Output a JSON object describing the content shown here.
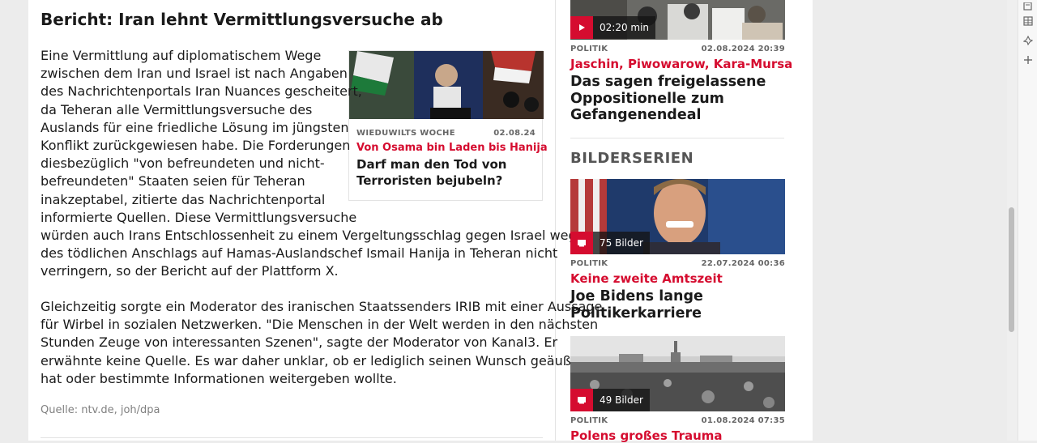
{
  "article": {
    "headline": "Bericht: Iran lehnt Vermittlungsversuche ab",
    "paragraph1_lines": [
      "Eine Vermittlung auf diplomatischem Wege",
      "zwischen dem Iran und Israel ist nach Angaben",
      "des Nachrichtenportals Iran Nuances gescheitert,",
      "da Teheran alle Vermittlungsversuche des",
      "Auslands für eine friedliche Lösung im jüngsten",
      "Konflikt zurückgewiesen habe. Die Forderungen",
      "diesbezüglich \"von befreundeten und nicht-",
      "befreundeten\" Staaten seien für Teheran",
      "inakzeptabel, zitierte das Nachrichtenportal",
      "informierte Quellen. Diese Vermittlungsversuche",
      "würden auch Irans Entschlossenheit zu einem Vergeltungsschlag gegen Israel wegen",
      "des tödlichen Anschlags auf Hamas-Auslandschef Ismail Hanija in Teheran nicht",
      "verringern, so der Bericht auf der Plattform X."
    ],
    "paragraph2_lines": [
      "Gleichzeitig sorgte ein Moderator des iranischen Staatssenders IRIB mit einer Aussage",
      "für Wirbel in sozialen Netzwerken. \"Die Menschen in der Welt werden in den nächsten",
      "Stunden Zeuge von interessanten Szenen\", sagte der Moderator von Kanal3. Er",
      "erwähnte keine Quelle. Es war daher unklar, ob er lediglich seinen Wunsch geäußert",
      "hat oder bestimmte Informationen weitergeben wollte."
    ],
    "source": "Quelle: ntv.de, joh/dpa"
  },
  "teaser": {
    "category": "WIEDUWILTS WOCHE",
    "date": "02.08.24",
    "kicker": "Von Osama bin Laden bis Hanija",
    "title": "Darf man den Tod von Terroristen bejubeln?"
  },
  "sidebar": {
    "video": {
      "duration": "02:20 min",
      "category": "POLITIK",
      "date": "02.08.2024 20:39",
      "kicker": "Jaschin, Piwowarow, Kara-Mursa",
      "title": "Das sagen freigelassene Oppositionelle zum Gefangenendeal"
    },
    "section_title": "BILDERSERIEN",
    "gallery1": {
      "count": "75 Bilder",
      "category": "POLITIK",
      "date": "22.07.2024 00:36",
      "kicker": "Keine zweite Amtszeit",
      "title": "Joe Bidens lange Politikerkarriere"
    },
    "gallery2": {
      "count": "49 Bilder",
      "category": "POLITIK",
      "date": "01.08.2024 07:35",
      "kicker": "Polens großes Trauma"
    }
  },
  "colors": {
    "accent": "#d50c2f",
    "text": "#1a1a1a",
    "muted": "#666666"
  },
  "icons": [
    "play-icon",
    "gallery-icon",
    "note-icon",
    "table-icon",
    "pin-icon",
    "plus-icon"
  ]
}
